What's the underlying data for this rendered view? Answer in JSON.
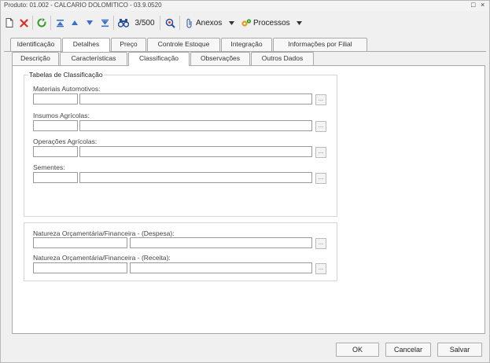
{
  "window": {
    "title": "Produto: 01.002 - CALCARIO DOLOMITICO - 03.9.0520",
    "restore_glyph": "□",
    "close_glyph": "×"
  },
  "toolbar": {
    "record_counter": "3/500",
    "anexos_label": "Anexos",
    "processos_label": "Processos",
    "icons": [
      "new-document-icon",
      "delete-icon",
      "refresh-icon",
      "first-record-icon",
      "previous-record-icon",
      "next-record-icon",
      "last-record-icon",
      "binoculars-icon",
      "zoom-icon",
      "attachment-icon",
      "processes-icon"
    ]
  },
  "tabs_primary": [
    "Identificação",
    "Detalhes",
    "Preço",
    "Controle Estoque",
    "Integração",
    "Informações por Filial"
  ],
  "tabs_secondary": [
    "Descrição",
    "Características",
    "Classificação",
    "Observações",
    "Outros Dados"
  ],
  "active_primary": "Detalhes",
  "active_secondary": "Classificação",
  "classificacao": {
    "group_title": "Tabelas de Classificação",
    "fields": [
      {
        "label": "Materiais Automotivos:",
        "code": "",
        "description": ""
      },
      {
        "label": "Insumos Agrícolas:",
        "code": "",
        "description": ""
      },
      {
        "label": "Operações Agrícolas:",
        "code": "",
        "description": ""
      },
      {
        "label": "Sementes:",
        "code": "",
        "description": ""
      }
    ],
    "lookup_glyph": "..."
  },
  "natureza": {
    "fields": [
      {
        "label": "Natureza Orçamentária/Financeira - (Despesa):",
        "code": "",
        "description": ""
      },
      {
        "label": "Natureza Orçamentária/Financeira - (Receita):",
        "code": "",
        "description": ""
      }
    ]
  },
  "buttons": {
    "ok": "OK",
    "cancel": "Cancelar",
    "save": "Salvar"
  },
  "colors": {
    "window_bg": "#f0f0f0",
    "pane_bg": "#ffffff",
    "delete_red": "#d9302a",
    "refresh_green": "#3a9a2a",
    "nav_blue": "#3a6fc8"
  }
}
